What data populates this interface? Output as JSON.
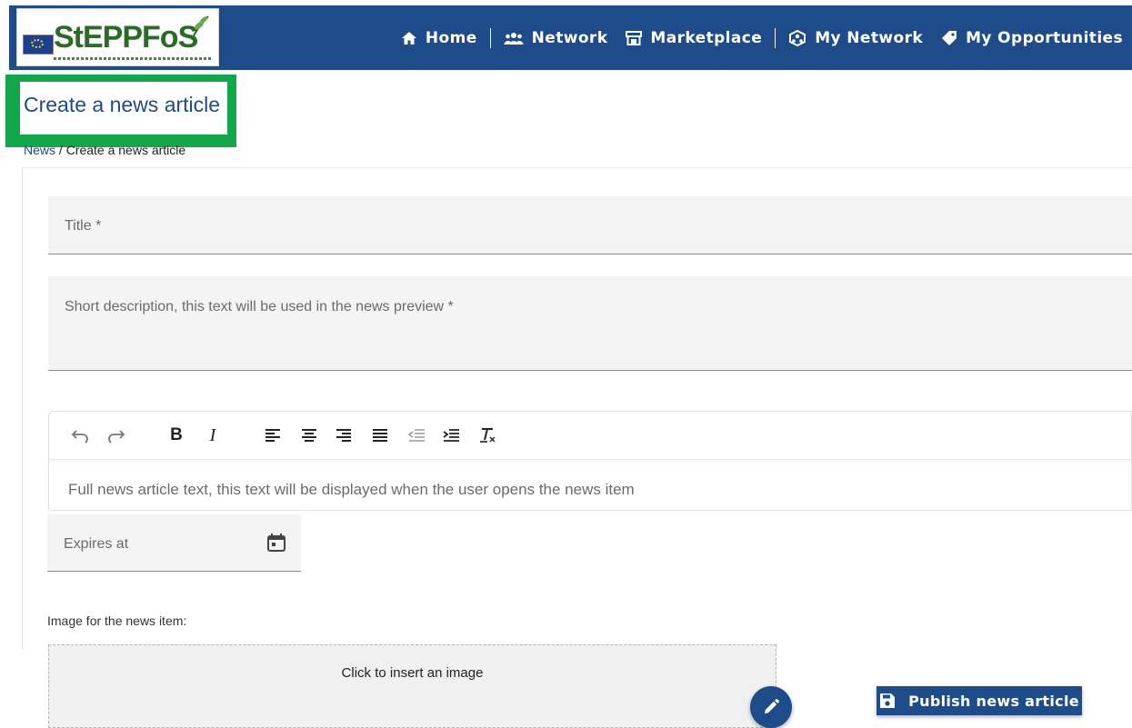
{
  "brand": {
    "logo_text": "StEPPFoS"
  },
  "nav": {
    "items": [
      {
        "label": "Home",
        "icon": "home-icon"
      },
      {
        "label": "Network",
        "icon": "users-icon"
      },
      {
        "label": "Marketplace",
        "icon": "store-icon"
      },
      {
        "label": "My Network",
        "icon": "network-icon"
      },
      {
        "label": "My Opportunities",
        "icon": "tag-icon"
      }
    ]
  },
  "header": {
    "title": "Create a news article",
    "breadcrumb": {
      "parent": "News",
      "separator": "/",
      "current": "Create a news article"
    }
  },
  "form": {
    "title_placeholder": "Title *",
    "description_placeholder": "Short description, this text will be used in the news preview *",
    "editor_placeholder": "Full news article text, this text will be displayed when the user opens the news item",
    "expires_placeholder": "Expires at",
    "image_label": "Image for the news item:",
    "image_dropzone_text": "Click to insert an image",
    "publish_label": "Publish news article"
  },
  "toolbar": {
    "buttons": [
      "undo",
      "redo",
      "bold",
      "italic",
      "align-left",
      "align-center",
      "align-right",
      "justify",
      "outdent",
      "indent",
      "clear-format"
    ],
    "bold_glyph": "B",
    "italic_glyph": "I"
  },
  "colors": {
    "primary": "#1e4b8a",
    "highlight": "#10a84a",
    "field_bg": "#f4f4f4"
  }
}
